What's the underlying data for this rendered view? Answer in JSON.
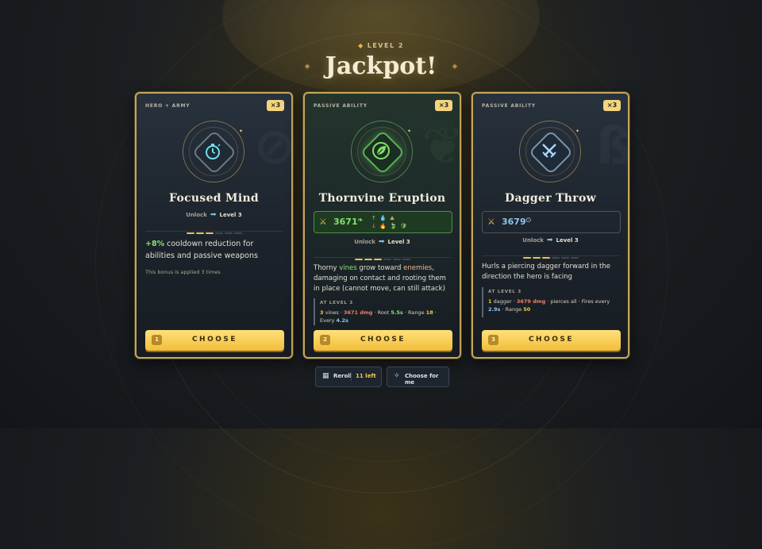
{
  "header": {
    "level_label": "LEVEL 2",
    "title": "Jackpot!"
  },
  "cards": [
    {
      "tag": "HERO + ARMY",
      "multiplier": "×3",
      "icon": "stopwatch-icon",
      "name": "Focused Mind",
      "unlock_label": "Unlock",
      "unlock_level": "Level 3",
      "pips_filled": 3,
      "pips_total": 6,
      "desc_highlight": "+8%",
      "desc_rest": " cooldown reduction for abilities and passive weapons",
      "note": "This bonus is applied 3 times",
      "choose_num": "1",
      "choose_label": "CHOOSE"
    },
    {
      "tag": "PASSIVE ABILITY",
      "multiplier": "×3",
      "icon": "leaf-icon",
      "name": "Thornvine Eruption",
      "stat_value": "3671",
      "stat_extras": [
        "↑",
        "💧",
        "⛰",
        "↓",
        "🔥",
        "🍃",
        "🛡"
      ],
      "unlock_label": "Unlock",
      "unlock_level": "Level 3",
      "pips_filled": 3,
      "pips_total": 6,
      "desc": {
        "p1": "Thorny ",
        "vines": "vines",
        "p2": " grow toward ",
        "enemies": "enemies",
        "p3": ", damaging on contact and rooting them in place (cannot move, can still attack)"
      },
      "at_level_label": "AT LEVEL 3",
      "at_level": {
        "n": "3",
        "n_lab": " vines · ",
        "dmg": "3671 dmg",
        "sep1": " · Root ",
        "root": "5.5s",
        "sep2": " · Range ",
        "range": "18",
        "sep3": " · Every ",
        "every": "4.2s"
      },
      "choose_num": "2",
      "choose_label": "CHOOSE"
    },
    {
      "tag": "PASSIVE ABILITY",
      "multiplier": "×3",
      "icon": "crossed-daggers-icon",
      "name": "Dagger Throw",
      "stat_value": "3679",
      "unlock_label": "Unlock",
      "unlock_level": "Level 3",
      "pips_filled": 3,
      "pips_total": 6,
      "desc": "Hurls a piercing dagger forward in the direction the hero is facing",
      "at_level_label": "AT LEVEL 3",
      "at_level": {
        "n": "1",
        "n_lab": " dagger · ",
        "dmg": "3679 dmg",
        "sep1": " · pierces all · Fires every ",
        "every": "2.9s",
        "sep2": " · Range ",
        "range": "50"
      },
      "choose_num": "3",
      "choose_label": "CHOOSE"
    }
  ],
  "footer": {
    "reroll_label": "Reroll",
    "reroll_left": "11 left",
    "choose_for_me_label": "Choose for me"
  },
  "colors": {
    "gold": "#e7c15b",
    "button": "#f2bd3a",
    "green": "#8ee272",
    "blue": "#8ec5ee",
    "damage": "#f07f6a"
  }
}
